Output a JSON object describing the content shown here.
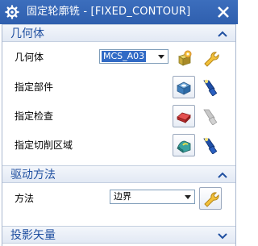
{
  "window": {
    "title": "固定轮廓铣 - [FIXED_CONTOUR]"
  },
  "sections": {
    "geometry": {
      "title": "几何体",
      "rows": [
        {
          "label": "几何体",
          "value": "MCS_A03"
        },
        {
          "label": "指定部件"
        },
        {
          "label": "指定检查"
        },
        {
          "label": "指定切削区域"
        }
      ]
    },
    "drive": {
      "title": "驱动方法",
      "method_label": "方法",
      "method_value": "边界"
    },
    "projection": {
      "title": "投影矢量"
    }
  },
  "colors": {
    "title_bar": "#3165b5",
    "section_title": "#1f4fa0"
  }
}
